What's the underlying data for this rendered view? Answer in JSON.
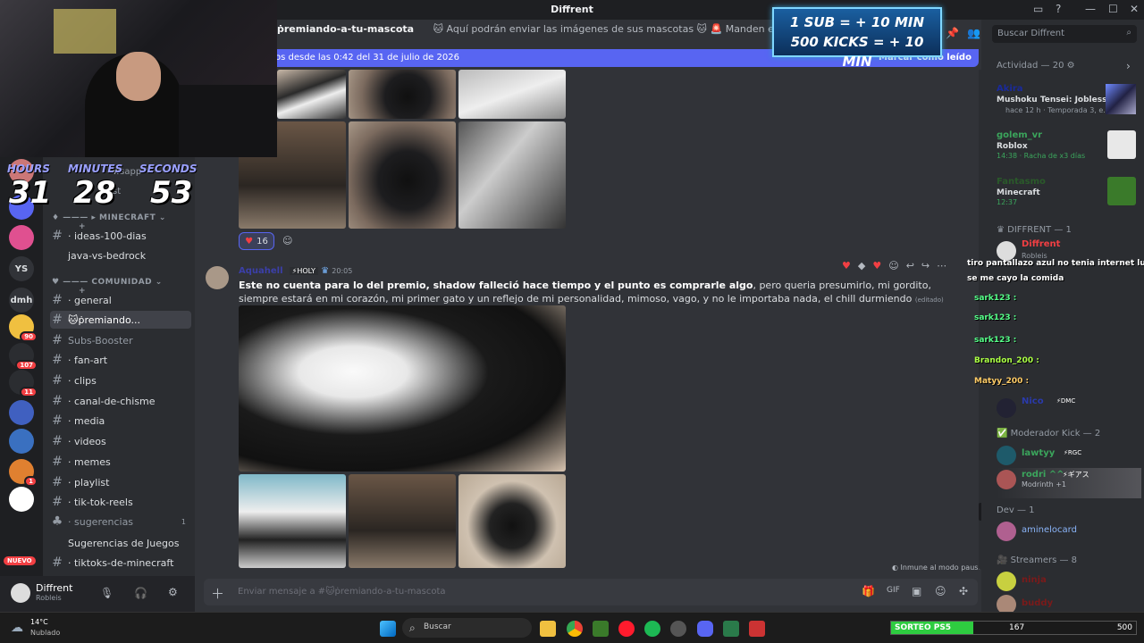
{
  "window": {
    "title": "Diffrent"
  },
  "timer": {
    "hours_label": "HOURS",
    "minutes_label": "MINUTES",
    "seconds_label": "SECONDS",
    "hours": "31",
    "minutes": "28",
    "seconds": "53"
  },
  "overlay": {
    "sub_line": "1 SUB = + 10 MIN",
    "kick_line": "500 KICKS = + 10 MIN"
  },
  "channel_header": {
    "name": "ṗremiando-a-tu-mascota",
    "topic": "🐱 Aquí podrán enviar las imágenes de sus mascotas 🐱 🚨 Manden en un solo mensaje todas las fotos de s"
  },
  "new_messages_bar": {
    "text": "os desde las 0:42 del 31 de julio de 2026",
    "action": "Marcar como leído"
  },
  "server_rail": {
    "items": [
      {
        "label": "",
        "badge": ""
      },
      {
        "label": "",
        "badge": ""
      },
      {
        "label": "",
        "badge": ""
      },
      {
        "label": "YS",
        "badge": ""
      },
      {
        "label": "dmh",
        "badge": ""
      },
      {
        "label": "",
        "badge": "90"
      },
      {
        "label": "",
        "badge": "107"
      },
      {
        "label": "",
        "badge": "11"
      },
      {
        "label": "",
        "badge": ""
      },
      {
        "label": "",
        "badge": ""
      },
      {
        "label": "",
        "badge": "1"
      },
      {
        "label": "",
        "badge": ""
      }
    ],
    "new_label": "NUEVO"
  },
  "channels": {
    "partial_top": "wsapp",
    "partial_top2": "st",
    "cat_minecraft": "MINECRAFT",
    "items_minecraft": [
      {
        "label": "· ideas-100-dias"
      },
      {
        "label": "java-vs-bedrock"
      }
    ],
    "cat_comunidad": "COMUNIDAD",
    "items_comunidad": [
      {
        "label": "· general"
      },
      {
        "label": "🐱ṗremiando..."
      },
      {
        "label": "Subs-Booster"
      },
      {
        "label": "· fan-art"
      },
      {
        "label": "· clips"
      },
      {
        "label": "· canal-de-chisme"
      },
      {
        "label": "· media"
      },
      {
        "label": "· videos"
      },
      {
        "label": "· memes"
      },
      {
        "label": "· playlist"
      },
      {
        "label": "· tik-tok-reels"
      },
      {
        "label": "· sugerencias",
        "count": "1"
      },
      {
        "label": "Sugerencias de Juegos"
      },
      {
        "label": "· tiktoks-de-minecraft"
      }
    ]
  },
  "user_panel": {
    "name": "Diffrent",
    "status": "Robleis"
  },
  "reaction": {
    "count": "16"
  },
  "message": {
    "author": "Aquahell",
    "badge": "HOLY",
    "time": "20:05",
    "bold_text": "Este no cuenta para lo del premio, shadow falleció hace tiempo y el punto es comprarle algo",
    "text": ", pero queria presumirlo, mi gordito, siempre estará en mi corazón, mi primer gato y un reflejo de mi personalidad, mimoso, vago, y no le importaba nada, el chill durmiendo",
    "edited": "(editado)"
  },
  "status_strip": {
    "text": "Inmune al modo pausado"
  },
  "composer": {
    "placeholder": "Enviar mensaje a #🐱ṗremiando-a-tu-mascota"
  },
  "members": {
    "search_placeholder": "Buscar Diffrent",
    "activity_header": "Actividad — 20",
    "activities": [
      {
        "name": "Akira",
        "line1": "Mushoku Tensei: Jobless R...",
        "line2": "hace 12 h · Temporada 3, e..."
      },
      {
        "name": "golem_vr",
        "line1": "Roblox",
        "line2": "14:38 · Racha de x3 días"
      },
      {
        "name": "Fantasmo",
        "line1": "Minecraft",
        "line2": "12:37"
      }
    ],
    "role_diffrent": "DIFFRENT — 1",
    "diffrent_member": {
      "name": "Diffrent",
      "status": "Robleis"
    },
    "role_mod": "Moderador Kick — 2",
    "mods": [
      {
        "name": "lawtyy",
        "tag": "RGC"
      },
      {
        "name": "rodri ^^",
        "tag": "ギアス",
        "status": "Modrinth +1"
      }
    ],
    "role_dev": "Dev — 1",
    "dev": {
      "name": "aminelocard"
    },
    "role_streamers": "Streamers — 8",
    "streamers": [
      {
        "name": "ninja"
      },
      {
        "name": "buddy"
      }
    ],
    "dmc_user": {
      "name": "Nico",
      "tag": "DMC"
    }
  },
  "kick_chat": [
    {
      "text": "tiro pantallazo azul no tenia internet luego y"
    },
    {
      "text": "se me cayo la comida"
    },
    {
      "text": "sark123 :"
    },
    {
      "text": "sark123 :"
    },
    {
      "text": "sark123 :"
    },
    {
      "text": "Brandon_200 :"
    },
    {
      "text": "Matyy_200 :"
    }
  ],
  "taskbar": {
    "weather_temp": "14°C",
    "weather_desc": "Nublado",
    "search": "Buscar",
    "progress_label": "SORTEO PS5",
    "progress_value": "167",
    "progress_max": "500",
    "progress_fraction": 0.334
  }
}
